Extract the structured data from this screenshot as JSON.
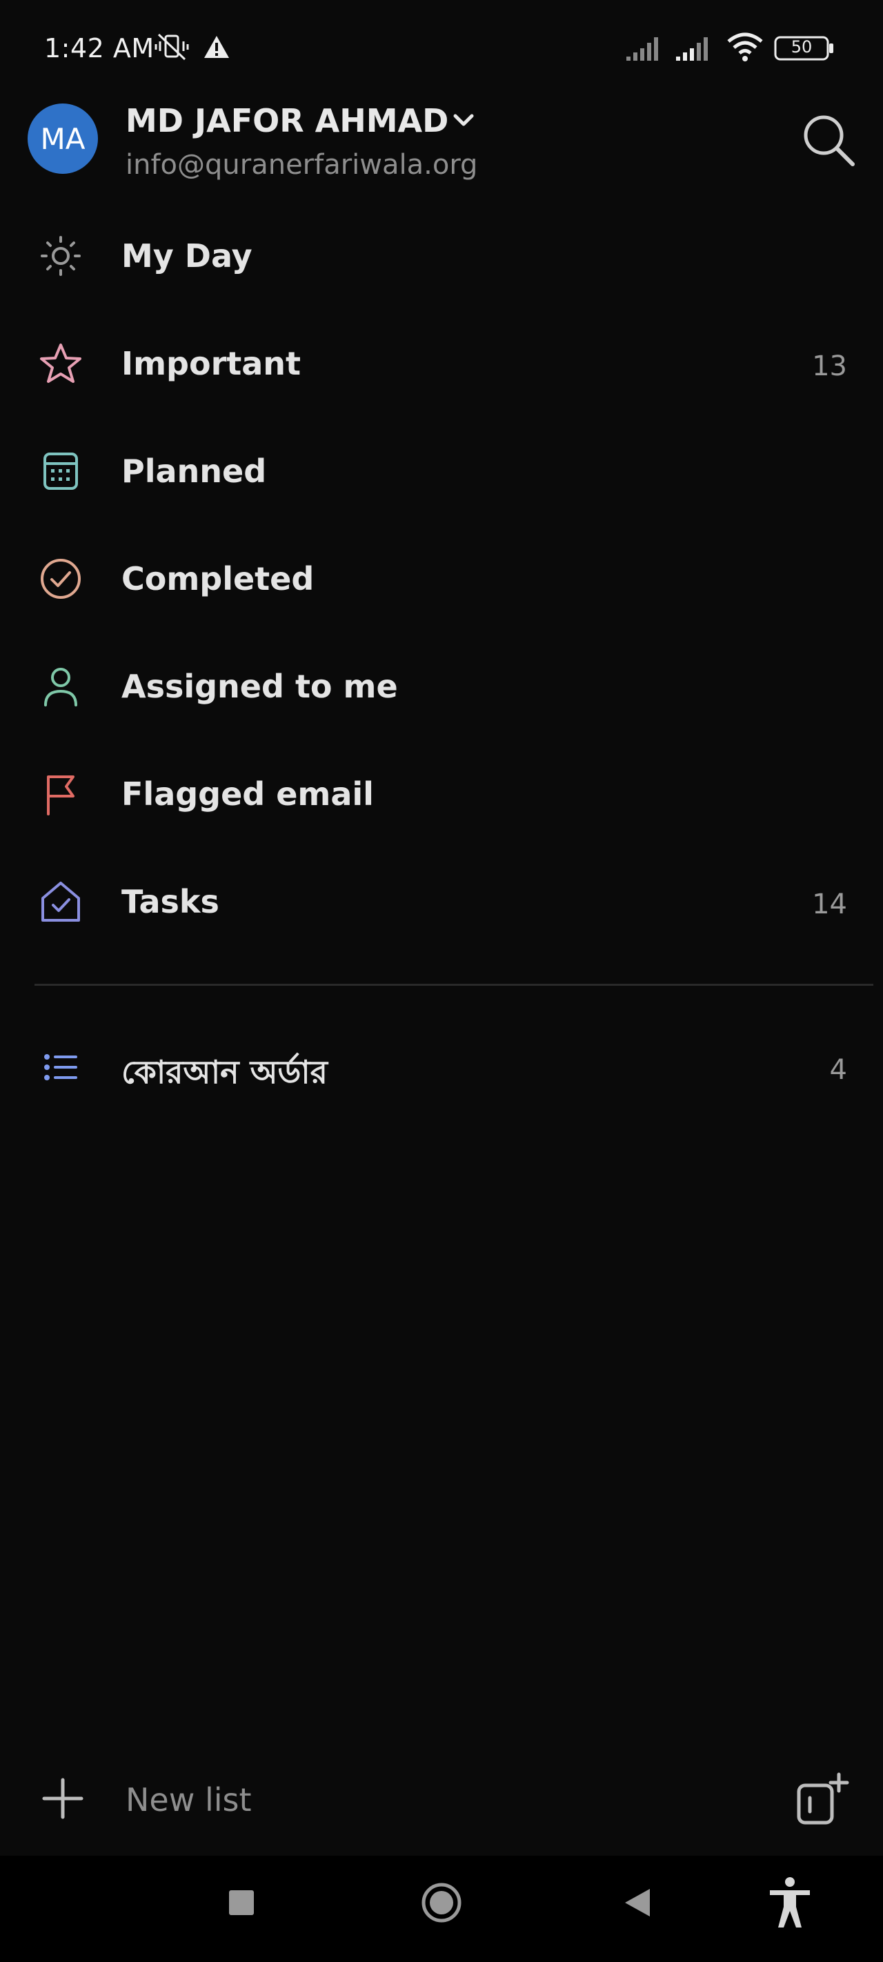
{
  "status_bar": {
    "time": "1:42 AM",
    "battery": "50"
  },
  "account": {
    "initials": "MA",
    "name": "MD JAFOR AHMAD",
    "email": "info@quranerfariwala.org"
  },
  "smart_lists": [
    {
      "label": "My Day",
      "count": "",
      "icon": "sun-icon",
      "color": "#9a9a9a"
    },
    {
      "label": "Important",
      "count": "13",
      "icon": "star-icon",
      "color": "#e7a0b4"
    },
    {
      "label": "Planned",
      "count": "",
      "icon": "calendar-icon",
      "color": "#7fc4c0"
    },
    {
      "label": "Completed",
      "count": "",
      "icon": "check-circle-icon",
      "color": "#e0a890"
    },
    {
      "label": "Assigned to me",
      "count": "",
      "icon": "person-icon",
      "color": "#7fc8a8"
    },
    {
      "label": "Flagged email",
      "count": "",
      "icon": "flag-icon",
      "color": "#e06b64"
    },
    {
      "label": "Tasks",
      "count": "14",
      "icon": "house-icon",
      "color": "#8a8fe0"
    }
  ],
  "custom_lists": [
    {
      "label": "কোরআন অর্ডার",
      "count": "4",
      "icon": "list-icon",
      "color": "#7f9bef"
    }
  ],
  "footer": {
    "new_list_label": "New list"
  }
}
